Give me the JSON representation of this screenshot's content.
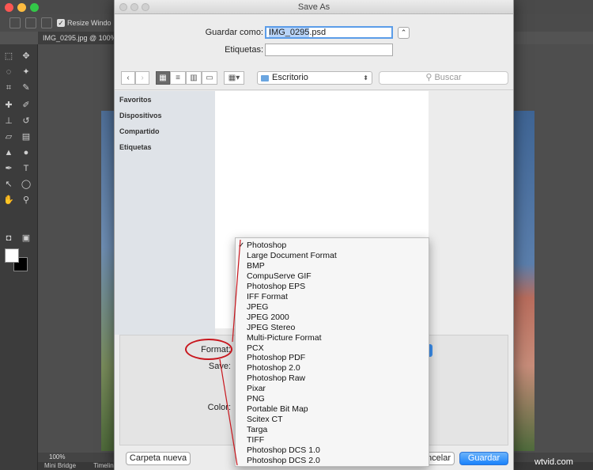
{
  "photoshop": {
    "options_bar": {
      "resize_windows_label": "Resize Windo"
    },
    "document_tab": "IMG_0295.jpg @ 100%",
    "status_zoom": "100%",
    "bottom_tabs": [
      "Mini Bridge",
      "Timeline"
    ]
  },
  "dialog": {
    "title": "Save As",
    "save_as_label": "Guardar como:",
    "filename": "IMG_0295.psd",
    "filename_selected_part": "IMG_0295",
    "filename_ext": ".psd",
    "tags_label": "Etiquetas:",
    "tags_value": "",
    "location": "Escritorio",
    "search_placeholder": "Buscar",
    "sidebar": [
      "Favoritos",
      "Dispositivos",
      "Compartido",
      "Etiquetas"
    ],
    "options": {
      "format_label": "Format:",
      "save_label": "Save:",
      "color_label": "Color:"
    },
    "buttons": {
      "new_folder": "Carpeta nueva",
      "cancel": "ancelar",
      "save": "Guardar"
    }
  },
  "format_menu": {
    "selected": "Photoshop",
    "items": [
      "Photoshop",
      "Large Document Format",
      "BMP",
      "CompuServe GIF",
      "Photoshop EPS",
      "IFF Format",
      "JPEG",
      "JPEG 2000",
      "JPEG Stereo",
      "Multi-Picture Format",
      "PCX",
      "Photoshop PDF",
      "Photoshop 2.0",
      "Photoshop Raw",
      "Pixar",
      "PNG",
      "Portable Bit Map",
      "Scitex CT",
      "Targa",
      "TIFF",
      "Photoshop DCS 1.0",
      "Photoshop DCS 2.0"
    ]
  },
  "colors": {
    "accent": "#1a82fb",
    "annotation": "#c8161d"
  },
  "watermark": "wtvid.com"
}
